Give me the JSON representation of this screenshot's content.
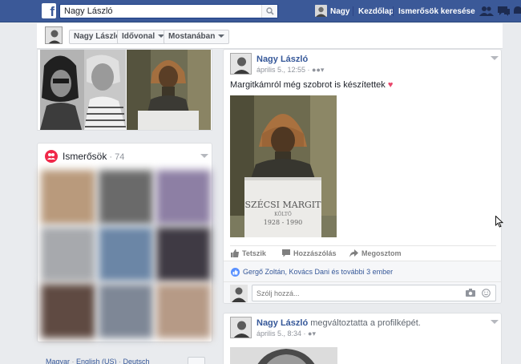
{
  "topbar": {
    "search_value": "Nagy László",
    "nav_profile_label": "Nagy",
    "nav_home_label": "Kezdőlap",
    "nav_friend_search_label": "Ismerősök keresése"
  },
  "subbar": {
    "name_button": "Nagy László",
    "timeline_button": "Idővonal",
    "now_button": "Mostanában"
  },
  "friends": {
    "title": "Ismerősök",
    "count": " · 74"
  },
  "footer": {
    "lang1": "Magyar",
    "lang2": "English (US)",
    "lang3": "Deutsch"
  },
  "post1": {
    "author": "Nagy László",
    "time": "április 5., 12:55",
    "text": "Margitkámról még szobrot is készítettek",
    "statue_plaque_name": "SZÉCSI MARGIT",
    "statue_plaque_role": "KÖLTŐ",
    "statue_plaque_years": "1928 - 1990",
    "like_label": "Tetszik",
    "comment_label": "Hozzászólás",
    "share_label": "Megosztom",
    "likes_text": "Gergő Zoltán, Kovács Dani és további 3 ember",
    "comment_placeholder": "Szólj hozzá..."
  },
  "post2": {
    "author": "Nagy László",
    "action": " megváltoztatta a profilképét.",
    "time": "április 5., 8:34"
  },
  "colors": {
    "brand_blue": "#3b5998",
    "link_blue": "#365899",
    "friends_icon": "#f02849"
  }
}
